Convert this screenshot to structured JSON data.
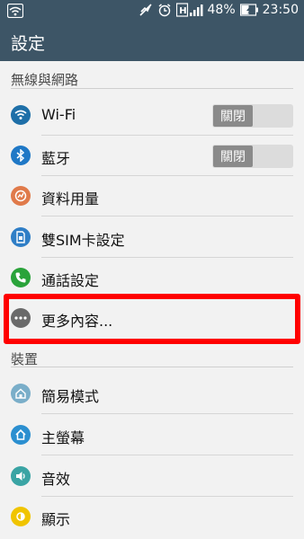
{
  "status_bar": {
    "battery": "48%",
    "time": "23:50",
    "icons": [
      "wifi-icon",
      "mute-icon",
      "alarm-icon",
      "hplus-signal-icon",
      "battery-charging-icon"
    ]
  },
  "app": {
    "title": "設定"
  },
  "sections": {
    "wireless": {
      "header": "無線與網路",
      "items": {
        "wifi": {
          "label": "Wi-Fi",
          "toggle": "關閉"
        },
        "bluetooth": {
          "label": "藍牙",
          "toggle": "關閉"
        },
        "data_usage": {
          "label": "資料用量"
        },
        "dual_sim": {
          "label": "雙SIM卡設定"
        },
        "call_settings": {
          "label": "通話設定"
        },
        "more": {
          "label": "更多內容..."
        }
      }
    },
    "device": {
      "header": "裝置",
      "items": {
        "easy_mode": {
          "label": "簡易模式"
        },
        "home": {
          "label": "主螢幕"
        },
        "sound": {
          "label": "音效"
        },
        "display": {
          "label": "顯示"
        }
      }
    }
  },
  "colors": {
    "bar": "#3d5566",
    "highlight": "#ff0000",
    "wifi": "#1e6fa8",
    "bluetooth": "#1f78c6",
    "data_usage": "#e07a4a",
    "dual_sim": "#2f7ec6",
    "call": "#2aa33a",
    "more": "#6a6a6a",
    "easy_mode": "#7aaec9",
    "home": "#2b8fd0",
    "sound": "#3aa4a4",
    "display": "#f0c400"
  }
}
